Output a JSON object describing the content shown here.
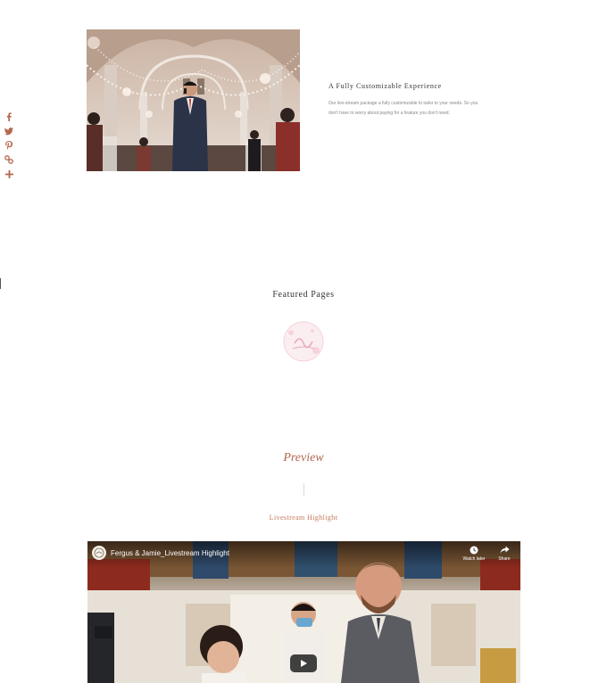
{
  "share_bar": {
    "icons": [
      "facebook-icon",
      "twitter-icon",
      "pinterest-icon",
      "link-icon",
      "more-icon"
    ],
    "color": "#b4674e"
  },
  "feature": {
    "title": "A Fully Customizable Experience",
    "description_line1": "Our live-stream package a fully customizable to tailor to your needs. So you",
    "description_line2": "don't have to worry about paying for a feature you don't need."
  },
  "featured_pages": {
    "title": "Featured Pages"
  },
  "preview": {
    "title": "Preview",
    "video_label": "Livestream Highlight"
  },
  "video": {
    "title": "Fergus & Jamie_Livestream Highlight",
    "watch_later": "Watch later",
    "share": "Share"
  },
  "colors": {
    "accent": "#b4674e",
    "label": "#c27a5a",
    "logo_pink": "#e8a9b7"
  }
}
